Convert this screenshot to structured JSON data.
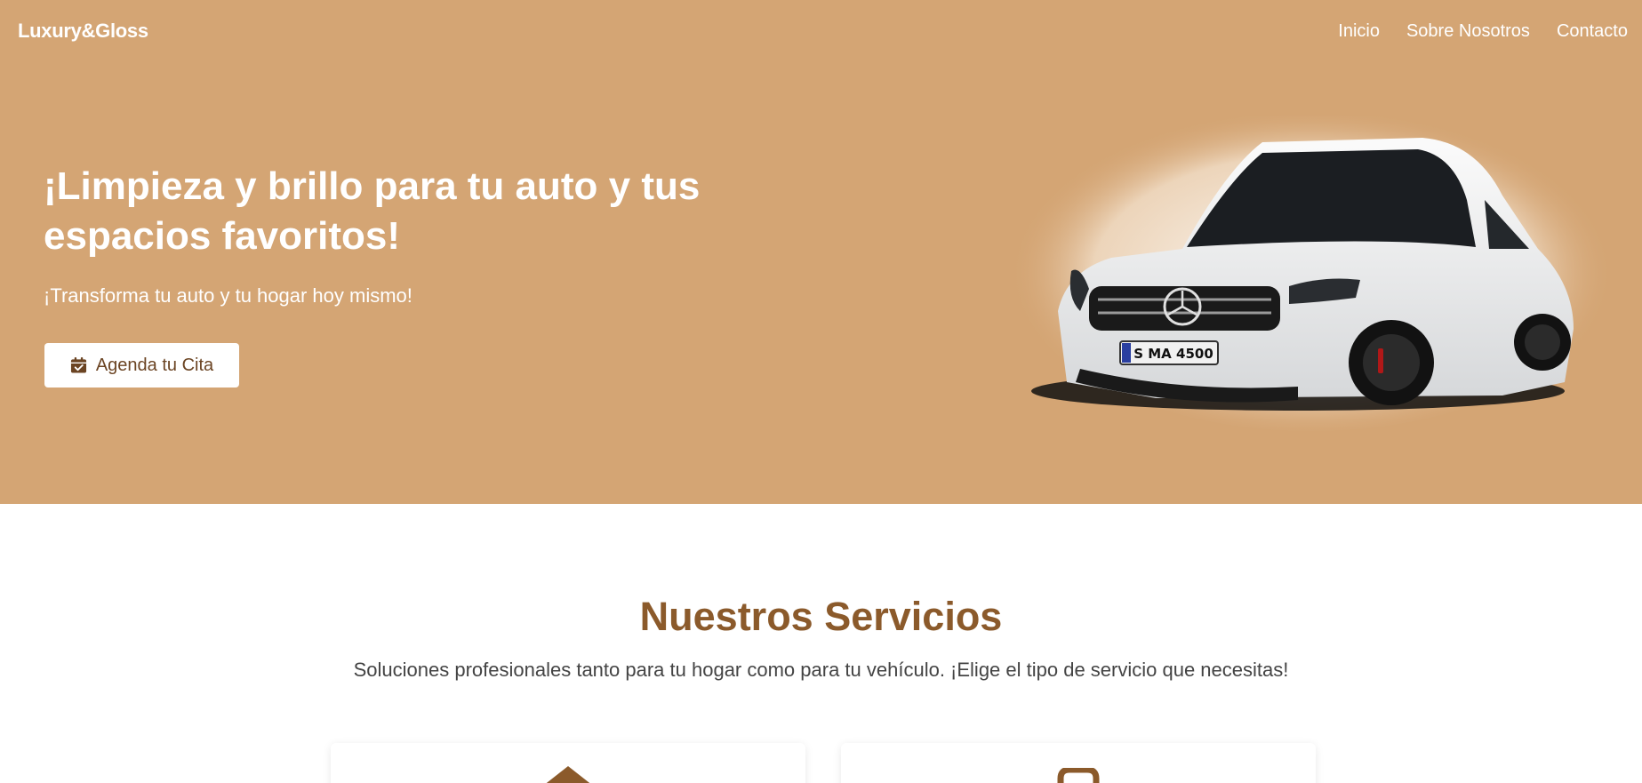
{
  "brand": "Luxury&Gloss",
  "nav": {
    "items": [
      {
        "label": "Inicio"
      },
      {
        "label": "Sobre Nosotros"
      },
      {
        "label": "Contacto"
      }
    ]
  },
  "hero": {
    "title": "¡Limpieza y brillo para tu auto y tus espacios favoritos!",
    "subtitle": "¡Transforma tu auto y tu hogar hoy mismo!",
    "cta_label": "Agenda tu Cita",
    "cta_icon": "calendar-check-icon",
    "image": "white-hatchback-car",
    "plate_text": "S MA 4500"
  },
  "services": {
    "title": "Nuestros Servicios",
    "subtitle": "Soluciones profesionales tanto para tu hogar como para tu vehículo. ¡Elige el tipo de servicio que necesitas!",
    "cards": [
      {
        "icon": "home-icon"
      },
      {
        "icon": "car-icon"
      }
    ]
  },
  "colors": {
    "hero_bg": "#d4a574",
    "accent": "#8b5a2b",
    "button_text": "#6b4423"
  }
}
